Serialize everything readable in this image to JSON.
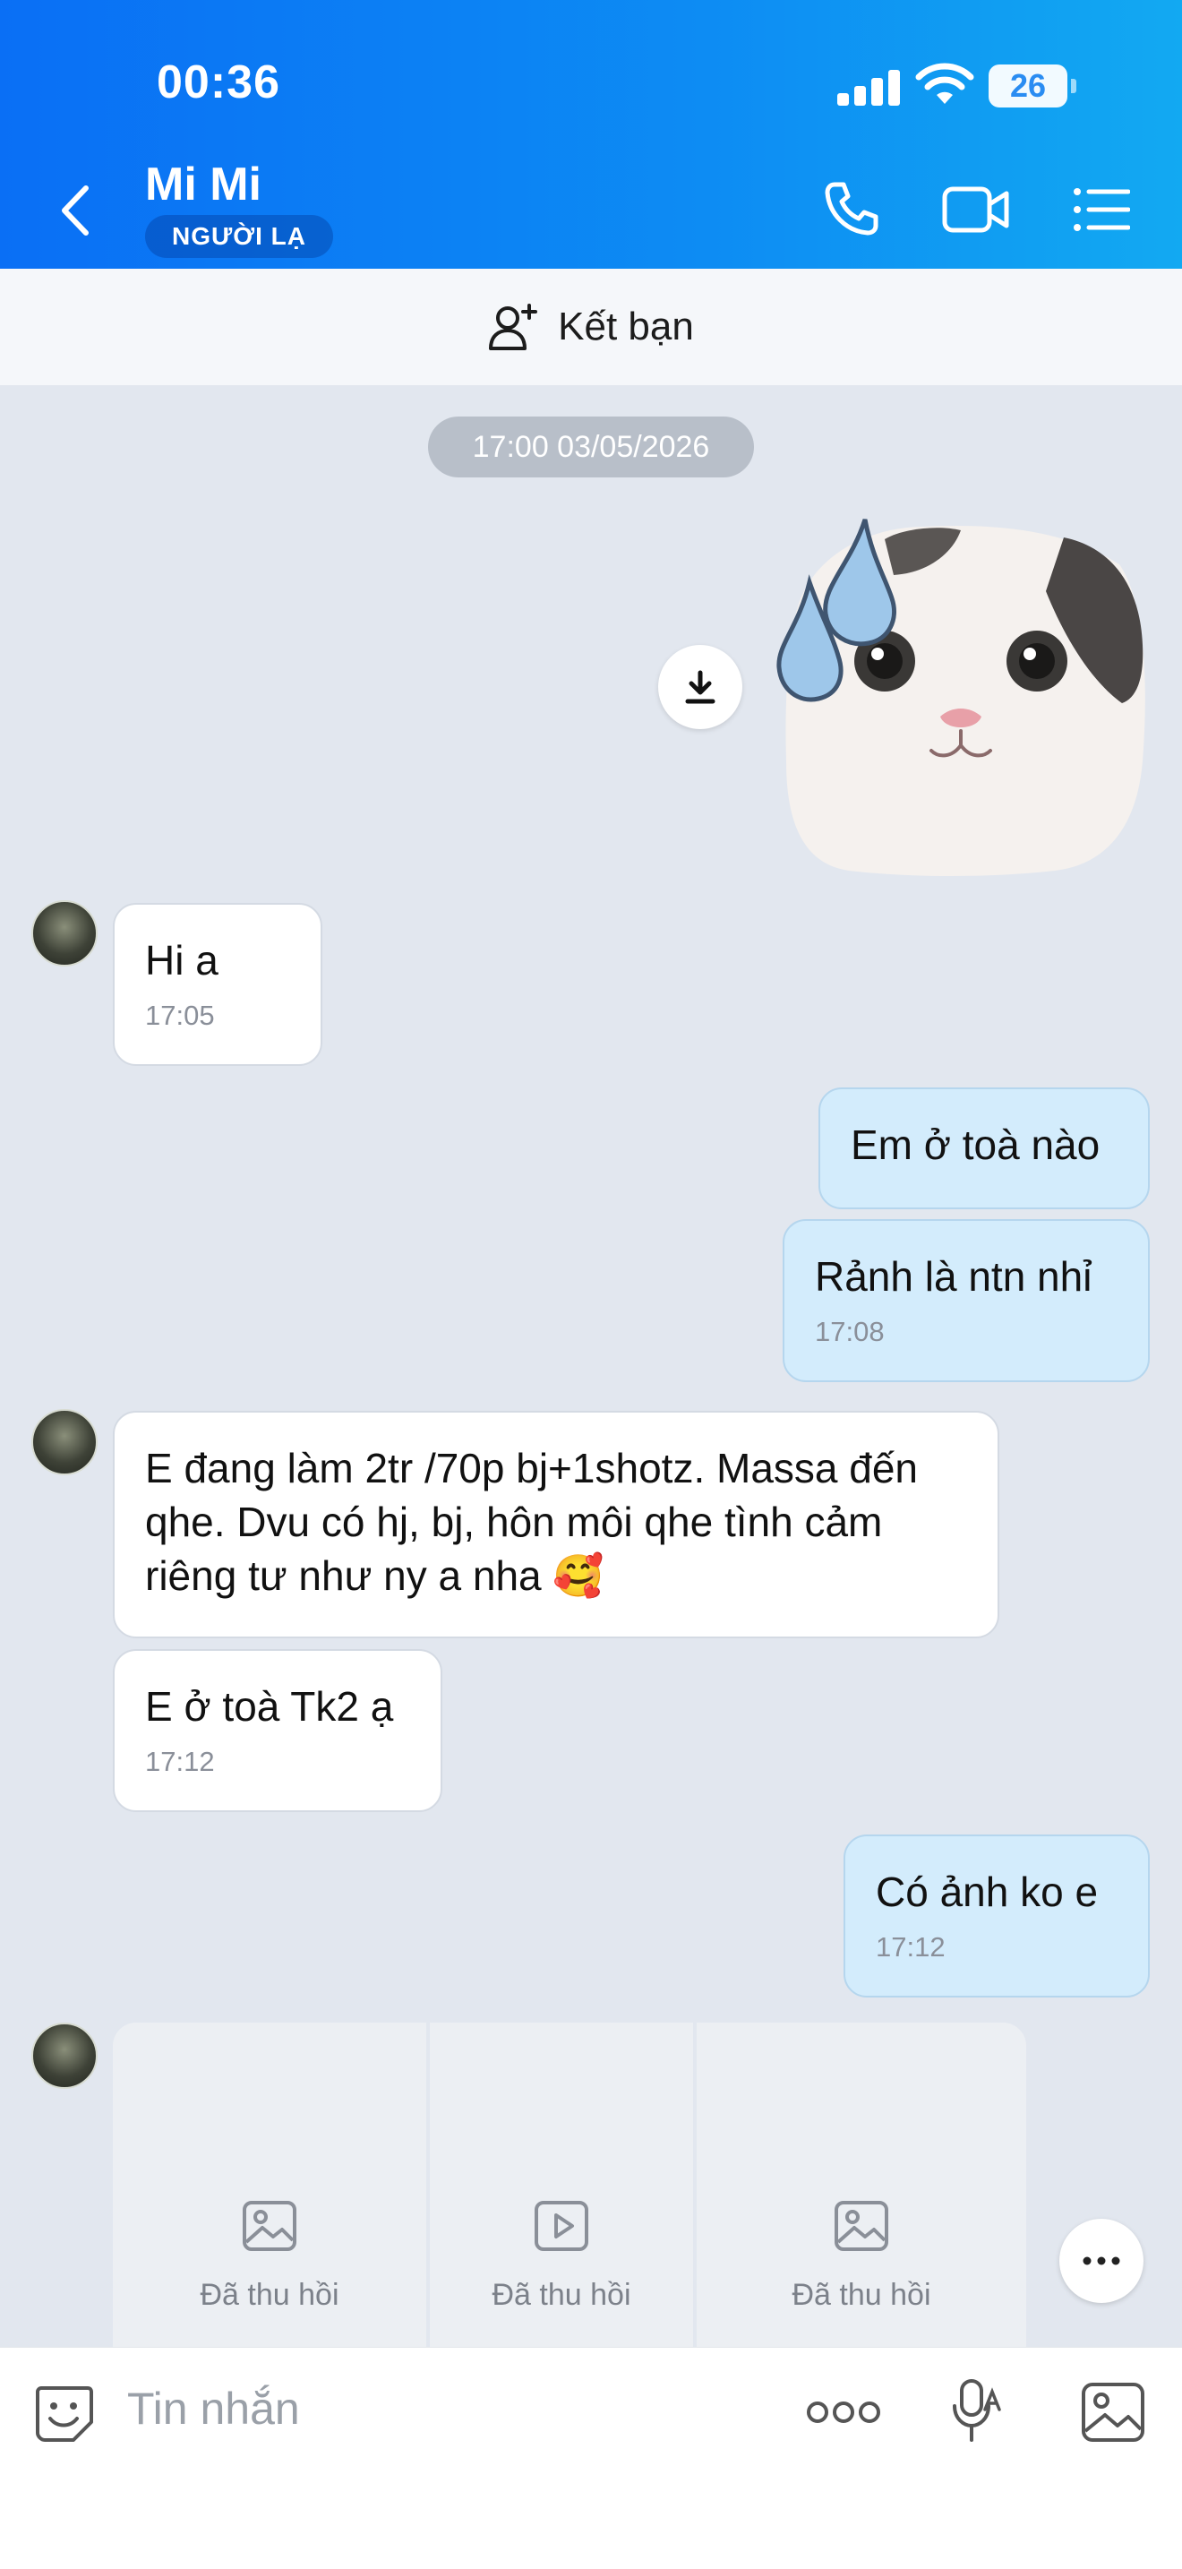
{
  "status": {
    "time": "00:36",
    "battery": "26"
  },
  "header": {
    "title": "Mi Mi",
    "badge": "NGƯỜI LẠ",
    "icons": [
      "back-icon",
      "phone-icon",
      "video-call-icon",
      "menu-list-icon"
    ]
  },
  "add_friend": {
    "label": "Kết bạn",
    "icon": "add-person-icon"
  },
  "chat": {
    "date_divider": "17:00 03/05/2026",
    "messages": [
      {
        "text": "Hi a",
        "time": "17:05"
      },
      {
        "text": "Em ở toà nào"
      },
      {
        "text": "Rảnh là ntn nhỉ",
        "time": "17:08"
      },
      {
        "text": "E đang làm 2tr /70p bj+1shotz. Massa đến qhe. Dvu có hj, bj, hôn môi qhe tình cảm riêng tư như ny a nha 🥰"
      },
      {
        "text": "E ở toà Tk2 ạ",
        "time": "17:12"
      },
      {
        "text": "Có ảnh ko e",
        "time": "17:12"
      }
    ],
    "recalled": [
      {
        "label": "Đã thu hồi",
        "icon": "image-icon"
      },
      {
        "label": "Đã thu hồi",
        "icon": "video-icon"
      },
      {
        "label": "Đã thu hồi",
        "icon": "image-icon"
      }
    ]
  },
  "composer": {
    "placeholder": "Tin nhắn",
    "icons": [
      "sticker-icon",
      "more-options-icon",
      "voice-to-text-icon",
      "gallery-icon"
    ]
  },
  "colors": {
    "header_blue": "#0a6ff5",
    "outgoing_bubble": "#d3ecfc",
    "incoming_bubble": "#ffffff",
    "chat_bg": "#e2e7ef"
  }
}
